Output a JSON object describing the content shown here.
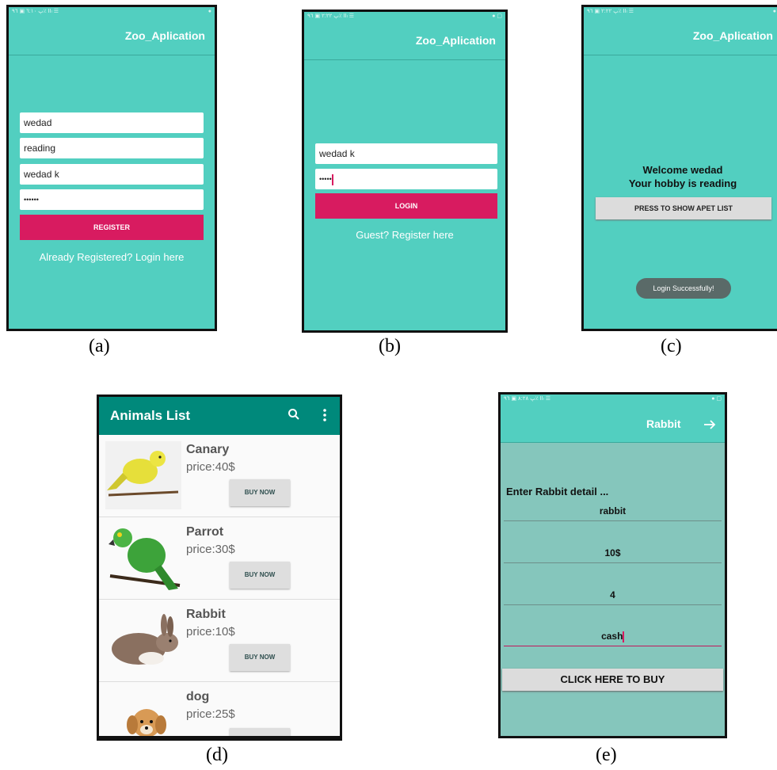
{
  "app_title": "Zoo_Aplication",
  "status_left_a": "ﭖ ٦:١٠ ▣ ٩٦٪ ⅠⅠₗ ☰",
  "status_left_b": "ﭖ ٢:٢٢ ▣ ٩٦٪ ⅠⅠₗ ☰",
  "status_left_c": "ﭖ ٢:٢٢ ▣ ٩٦٪ ⅠⅠₗ ☰",
  "status_left_e": "ﭖ ٨:٢٨ ▣ ٩٦٪ ⅠⅠₗ ☰",
  "screen_a": {
    "fields": [
      "wedad",
      "reading",
      "wedad k",
      "••••••"
    ],
    "register_label": "REGISTER",
    "login_link": "Already Registered? Login here"
  },
  "screen_b": {
    "fields": [
      "wedad k",
      "•••••"
    ],
    "login_label": "LOGIN",
    "register_link": "Guest? Register here"
  },
  "screen_c": {
    "welcome": "Welcome wedad",
    "hobby": "Your hobby is reading",
    "show_list_label": "PRESS TO SHOW APET LIST",
    "toast": "Login Successfully!"
  },
  "screen_d": {
    "title": "Animals List",
    "buy_label": "BUY NOW",
    "items": [
      {
        "name": "Canary",
        "price": "price:40$"
      },
      {
        "name": "Parrot",
        "price": "price:30$"
      },
      {
        "name": "Rabbit",
        "price": "price:10$"
      },
      {
        "name": "dog",
        "price": "price:25$"
      }
    ]
  },
  "screen_e": {
    "title": "Rabbit",
    "heading": "Enter Rabbit detail ...",
    "values": [
      "rabbit",
      "10$",
      "4",
      "cash"
    ],
    "buy_label": "CLICK HERE TO BUY"
  },
  "captions": [
    "(a)",
    "(b)",
    "(c)",
    "(d)",
    "(e)"
  ],
  "colors": {
    "teal": "#52cfc0",
    "pink": "#d81b60",
    "dark_teal": "#009688",
    "light_teal_e": "#85c6bc"
  }
}
